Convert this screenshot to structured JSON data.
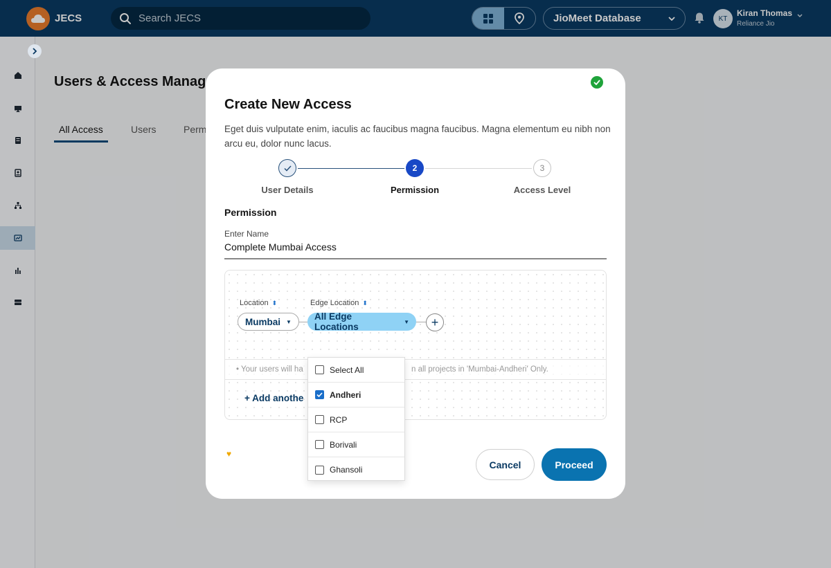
{
  "app": {
    "brand": "JECS",
    "search_placeholder": "Search JECS",
    "database_label": "JioMeet Database",
    "user": {
      "initials": "KT",
      "name": "Kiran Thomas",
      "org": "Reliance Jio"
    }
  },
  "sidebar": {
    "items": [
      "home-icon",
      "monitor-icon",
      "server-icon",
      "badge-icon",
      "network-icon",
      "chart-card-icon",
      "bar-chart-icon",
      "storage-icon"
    ],
    "active_index": 5
  },
  "page": {
    "title": "Users & Access Manag",
    "tabs": [
      {
        "label": "All Access",
        "active": true
      },
      {
        "label": "Users",
        "active": false
      },
      {
        "label": "Perm",
        "active": false
      }
    ]
  },
  "modal": {
    "title": "Create New Access",
    "description": "Eget duis vulputate enim, iaculis ac faucibus magna faucibus. Magna elementum eu nibh non arcu eu, dolor nunc lacus.",
    "steps": [
      {
        "number": "1",
        "label": "User Details",
        "state": "done"
      },
      {
        "number": "2",
        "label": "Permission",
        "state": "current"
      },
      {
        "number": "3",
        "label": "Access Level",
        "state": "pending"
      }
    ],
    "section_title": "Permission",
    "name_field": {
      "label": "Enter Name",
      "value": "Complete Mumbai Access"
    },
    "location_label": "Location",
    "edge_location_label": "Edge Location",
    "location_value": "Mumbai",
    "edge_location_value": "All Edge Locations",
    "info_text_left": "Your users will ha",
    "info_text_right": "n all projects in 'Mumbai-Andheri' Only.",
    "add_another_label": "Add anothe",
    "cancel_label": "Cancel",
    "proceed_label": "Proceed",
    "dropdown_options": [
      {
        "label": "Select All",
        "checked": false
      },
      {
        "label": "Andheri",
        "checked": true
      },
      {
        "label": "RCP",
        "checked": false
      },
      {
        "label": "Borivali",
        "checked": false
      },
      {
        "label": "Ghansoli",
        "checked": false
      }
    ]
  },
  "colors": {
    "topbar": "#0a3a63",
    "primary_button": "#0a73b0",
    "step_current": "#1848c6",
    "edge_pill": "#8fd2f5",
    "checkbox_checked": "#1a6ec9",
    "success": "#1fa33a"
  }
}
